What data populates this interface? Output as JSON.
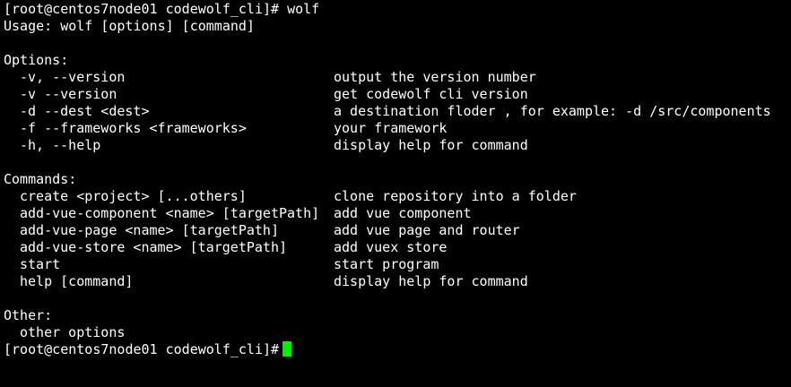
{
  "prompt_start": {
    "prefix": "[root@centos7node01 codewolf_cli]#",
    "command": "wolf"
  },
  "usage": "Usage: wolf [options] [command]",
  "options": {
    "heading": "Options:",
    "items": [
      {
        "flag": "-v, --version",
        "desc": "output the version number"
      },
      {
        "flag": "-v --version",
        "desc": "get codewolf cli version"
      },
      {
        "flag": "-d --dest <dest>",
        "desc": "a destination floder , for example: -d /src/components"
      },
      {
        "flag": "-f --frameworks <frameworks>",
        "desc": "your framework"
      },
      {
        "flag": "-h, --help",
        "desc": "display help for command"
      }
    ]
  },
  "commands": {
    "heading": "Commands:",
    "items": [
      {
        "name": "create <project> [...others]",
        "desc": "clone repository into a folder"
      },
      {
        "name": "add-vue-component <name> [targetPath]",
        "desc": "add vue component"
      },
      {
        "name": "add-vue-page <name> [targetPath]",
        "desc": "add vue page and router"
      },
      {
        "name": "add-vue-store <name> [targetPath]",
        "desc": "add vuex store"
      },
      {
        "name": "start",
        "desc": "start program"
      },
      {
        "name": "help [command]",
        "desc": "display help for command"
      }
    ]
  },
  "other": {
    "heading": "Other:",
    "items": [
      "other options"
    ]
  },
  "prompt_end": {
    "prefix": "[root@centos7node01 codewolf_cli]#"
  },
  "colors": {
    "background": "#000000",
    "text": "#ffffff",
    "cursor": "#00ee00"
  }
}
